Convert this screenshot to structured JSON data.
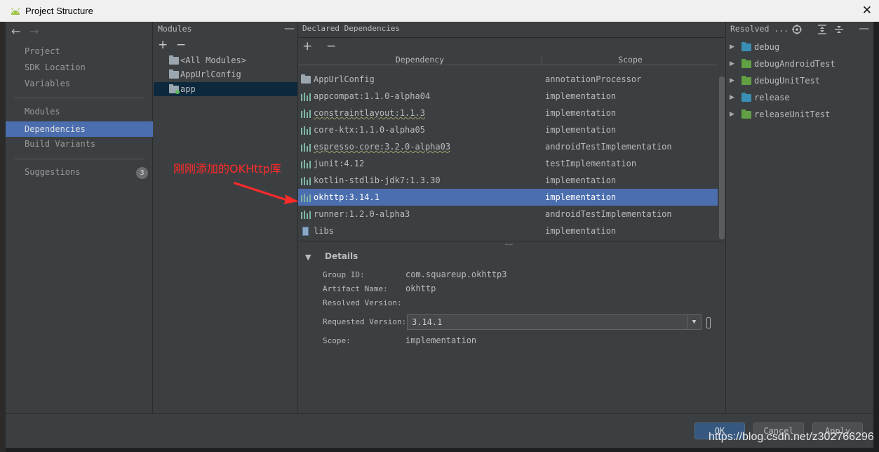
{
  "window": {
    "title": "Project Structure"
  },
  "nav": {
    "items": [
      {
        "label": "Project"
      },
      {
        "label": "SDK Location"
      },
      {
        "label": "Variables"
      },
      {
        "label": "Modules"
      },
      {
        "label": "Dependencies"
      },
      {
        "label": "Build Variants"
      },
      {
        "label": "Suggestions"
      }
    ],
    "selected": "Dependencies",
    "suggestions_count": "3"
  },
  "modules": {
    "header": "Modules",
    "items": [
      {
        "label": "<All Modules>"
      },
      {
        "label": "AppUrlConfig"
      },
      {
        "label": "app"
      }
    ],
    "selected": "app"
  },
  "deps": {
    "header": "Declared Dependencies",
    "columns": [
      "Dependency",
      "Scope"
    ],
    "rows": [
      {
        "name": "AppUrlConfig",
        "scope": "annotationProcessor",
        "icon": "module-icon"
      },
      {
        "name": "appcompat:1.1.0-alpha04",
        "scope": "implementation",
        "icon": "library-icon"
      },
      {
        "name": "constraintlayout:1.1.3",
        "scope": "implementation",
        "icon": "library-icon"
      },
      {
        "name": "core-ktx:1.1.0-alpha05",
        "scope": "implementation",
        "icon": "library-icon"
      },
      {
        "name": "espresso-core:3.2.0-alpha03",
        "scope": "androidTestImplementation",
        "icon": "library-icon"
      },
      {
        "name": "junit:4.12",
        "scope": "testImplementation",
        "icon": "library-icon"
      },
      {
        "name": "kotlin-stdlib-jdk7:1.3.30",
        "scope": "implementation",
        "icon": "library-icon"
      },
      {
        "name": "okhttp:3.14.1",
        "scope": "implementation",
        "icon": "library-icon"
      },
      {
        "name": "runner:1.2.0-alpha3",
        "scope": "androidTestImplementation",
        "icon": "library-icon"
      },
      {
        "name": "libs",
        "scope": "implementation",
        "icon": "jar-icon"
      }
    ],
    "selected": "okhttp:3.14.1"
  },
  "details": {
    "title": "Details",
    "group_id_label": "Group ID:",
    "group_id": "com.squareup.okhttp3",
    "artifact_label": "Artifact Name:",
    "artifact": "okhttp",
    "resolved_label": "Resolved Version:",
    "requested_label": "Requested Version:",
    "requested": "3.14.1",
    "scope_label": "Scope:",
    "scope": "implementation"
  },
  "resolved": {
    "header": "Resolved ...",
    "items": [
      {
        "label": "debug",
        "color": "#3a8fb7"
      },
      {
        "label": "debugAndroidTest",
        "color": "#62a044"
      },
      {
        "label": "debugUnitTest",
        "color": "#62a044"
      },
      {
        "label": "release",
        "color": "#3a8fb7"
      },
      {
        "label": "releaseUnitTest",
        "color": "#62a044"
      }
    ]
  },
  "buttons": {
    "ok": "OK",
    "cancel": "Cancel",
    "apply": "Apply"
  },
  "annotation": "刚刚添加的OKHttp库",
  "watermark": "https://blog.csdn.net/z302766296",
  "colors": {
    "accent": "#4b6eaf",
    "annotation": "#ff2a2a"
  }
}
